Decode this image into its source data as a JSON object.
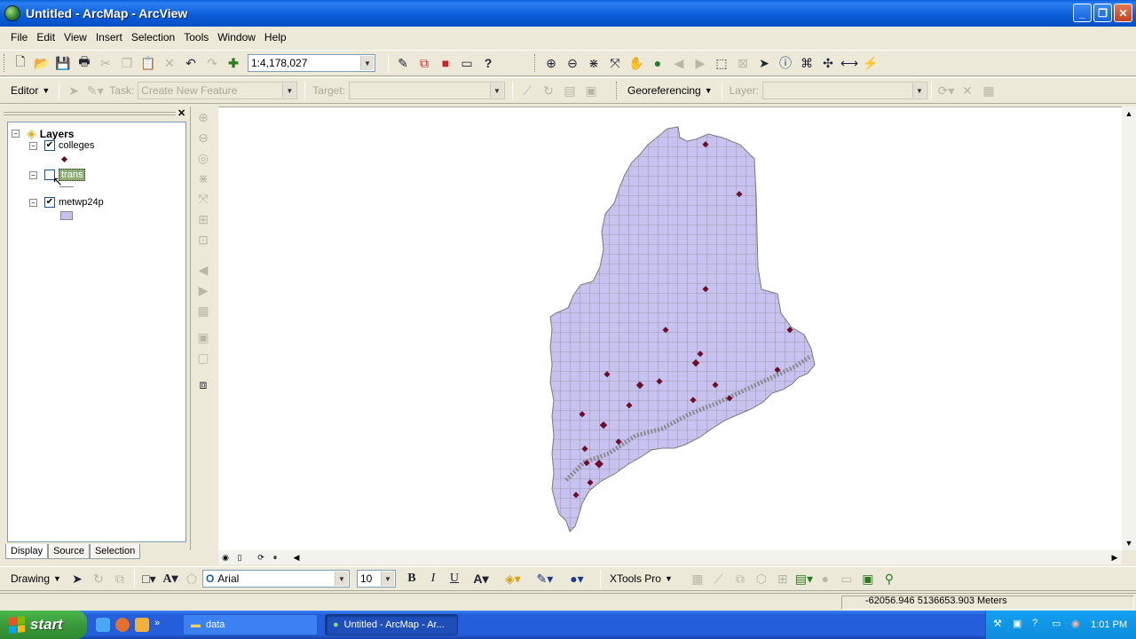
{
  "window": {
    "title": "Untitled - ArcMap - ArcView"
  },
  "menu": [
    "File",
    "Edit",
    "View",
    "Insert",
    "Selection",
    "Tools",
    "Window",
    "Help"
  ],
  "standard_toolbar": {
    "scale_value": "1:4,178,027"
  },
  "editor_toolbar": {
    "editor_label": "Editor",
    "task_label": "Task:",
    "task_value": "Create New Feature",
    "target_label": "Target:",
    "target_value": "",
    "georef_label": "Georeferencing",
    "layer_label": "Layer:",
    "layer_value": ""
  },
  "toc": {
    "root_label": "Layers",
    "layers": [
      {
        "name": "colleges",
        "checked": true,
        "selected": false
      },
      {
        "name": "trans",
        "checked": false,
        "selected": true
      },
      {
        "name": "metwp24p",
        "checked": true,
        "selected": false
      }
    ],
    "tabs": [
      "Display",
      "Source",
      "Selection"
    ],
    "active_tab": "Display"
  },
  "drawing_toolbar": {
    "drawing_label": "Drawing",
    "font_name": "Arial",
    "font_size": "10",
    "bold": "B",
    "italic": "I",
    "underline": "U",
    "xtools_label": "XTools Pro"
  },
  "status": {
    "coords": "-62056.946  5136653.903 Meters"
  },
  "taskbar": {
    "start_label": "start",
    "tasks": [
      "data",
      "Untitled - ArcMap - Ar..."
    ],
    "time": "1:01 PM"
  },
  "colors": {
    "titlebar": "#0a5fd8",
    "map_fill": "#c8c2f0",
    "map_stroke": "#7a7a7a",
    "college_point": "#6b0f2a",
    "selected_layer": "#8fae74"
  }
}
